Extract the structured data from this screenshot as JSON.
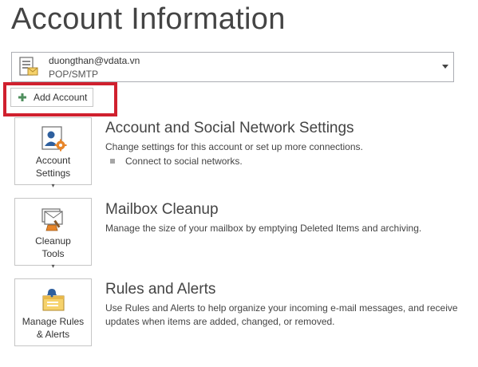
{
  "page_title": "Account Information",
  "account_selector": {
    "email": "duongthan@vdata.vn",
    "type": "POP/SMTP",
    "icon": "account-card-icon"
  },
  "add_account": {
    "label": "Add Account",
    "icon": "plus-icon",
    "highlight_color": "#d0202e"
  },
  "sections": {
    "account_settings": {
      "title": "Account and Social Network Settings",
      "description": "Change settings for this account or set up more connections.",
      "bullet": "Connect to social networks.",
      "button_line1": "Account",
      "button_line2": "Settings",
      "icon": "account-settings-icon"
    },
    "mailbox_cleanup": {
      "title": "Mailbox Cleanup",
      "description": "Manage the size of your mailbox by emptying Deleted Items and archiving.",
      "button_line1": "Cleanup",
      "button_line2": "Tools",
      "icon": "cleanup-tools-icon"
    },
    "rules_alerts": {
      "title": "Rules and Alerts",
      "description_line1": "Use Rules and Alerts to help organize your incoming e-mail messages, and receive",
      "description_line2": "updates when items are added, changed, or removed.",
      "button_line1": "Manage Rules",
      "button_line2": "& Alerts",
      "icon": "rules-alerts-icon"
    }
  },
  "colors": {
    "accent_orange": "#e8862a",
    "accent_blue": "#2e5f9e",
    "plus_green": "#4f8f5e"
  }
}
